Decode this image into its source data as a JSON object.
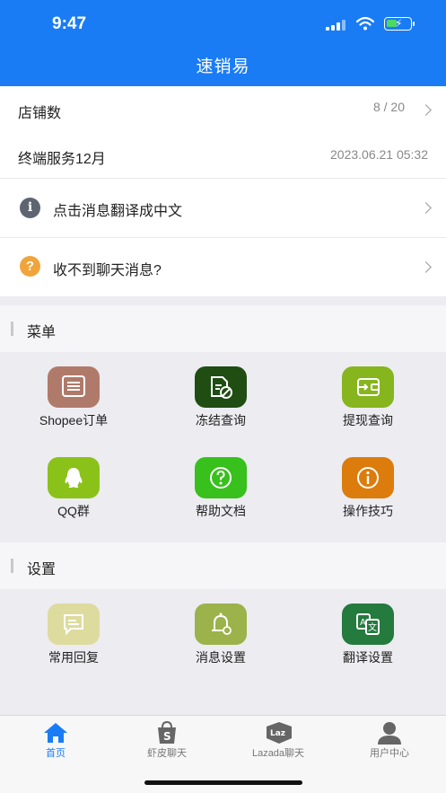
{
  "status": {
    "time": "9:47"
  },
  "header": {
    "title": "速销易"
  },
  "info": {
    "shop_count_label": "店铺数",
    "shop_count_value": "8 / 20",
    "service_label": "终端服务12月",
    "service_value": "2023.06.21 05:32",
    "translate_label": "点击消息翻译成中文",
    "no_msg_label": "收不到聊天消息?"
  },
  "menu": {
    "title": "菜单",
    "items": [
      {
        "label": "Shopee订单",
        "icon": "order-icon",
        "color": "#b07a6a"
      },
      {
        "label": "冻结查询",
        "icon": "frozen-doc-icon",
        "color": "#1f4d12"
      },
      {
        "label": "提现查询",
        "icon": "wallet-icon",
        "color": "#86b51e"
      },
      {
        "label": "QQ群",
        "icon": "qq-icon",
        "color": "#8bc21a"
      },
      {
        "label": "帮助文档",
        "icon": "help-icon",
        "color": "#38c01c"
      },
      {
        "label": "操作技巧",
        "icon": "info-icon",
        "color": "#dc7c0c"
      }
    ]
  },
  "settings": {
    "title": "设置",
    "items": [
      {
        "label": "常用回复",
        "icon": "quick-reply-icon",
        "color": "#dedb9e"
      },
      {
        "label": "消息设置",
        "icon": "bell-settings-icon",
        "color": "#9bb34a"
      },
      {
        "label": "翻译设置",
        "icon": "translate-icon",
        "color": "#257a3e"
      }
    ]
  },
  "tabs": [
    {
      "label": "首页",
      "icon": "home-icon",
      "active": true
    },
    {
      "label": "虾皮聊天",
      "icon": "shopee-icon",
      "active": false
    },
    {
      "label": "Lazada聊天",
      "icon": "lazada-icon",
      "active": false
    },
    {
      "label": "用户中心",
      "icon": "user-icon",
      "active": false
    }
  ]
}
